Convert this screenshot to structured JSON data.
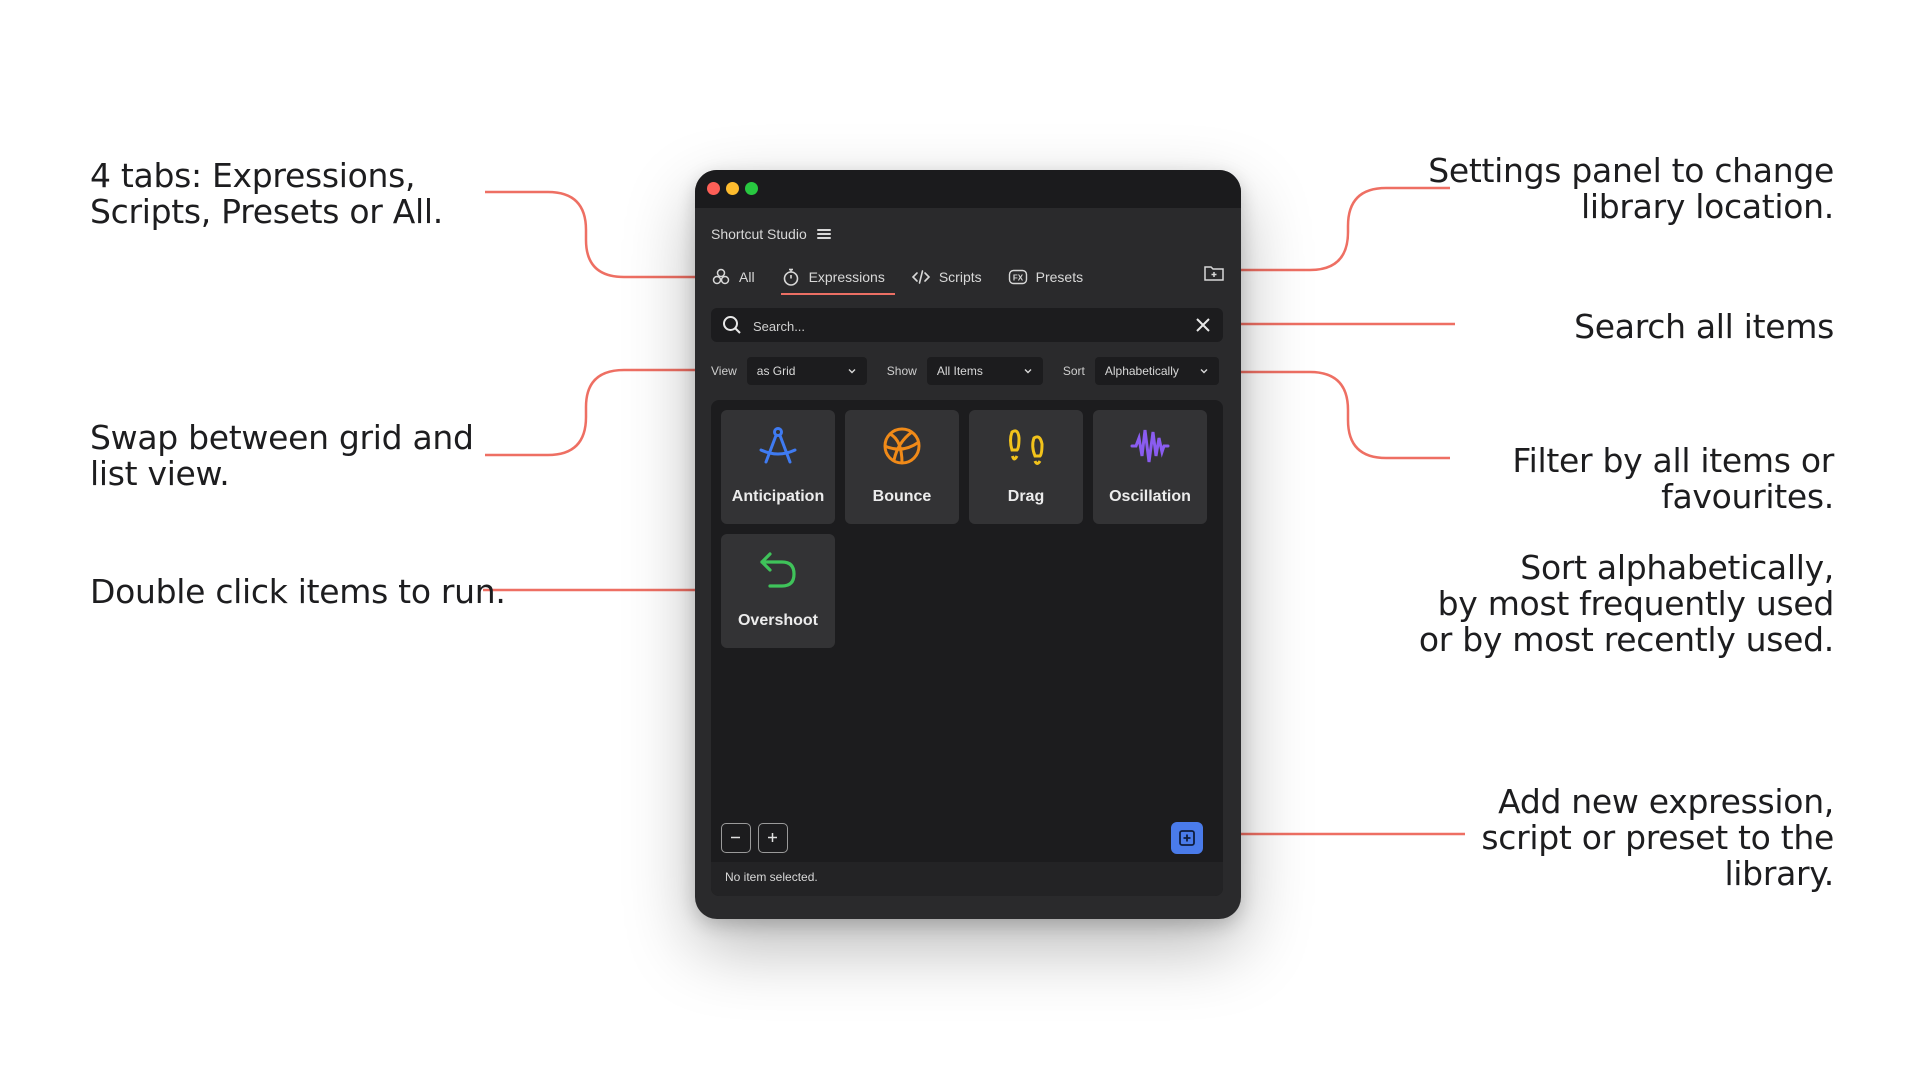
{
  "callouts": {
    "tabs": "4 tabs: Expressions,\nScripts, Presets or All.",
    "settings": "Settings panel to change\nlibrary location.",
    "search": "Search all items",
    "view": "Swap between grid and\nlist view.",
    "filter": "Filter by all items or\nfavourites.",
    "sort": "Sort alphabetically,\nby most frequently used\nor by most recently used.",
    "run": "Double click items to run.",
    "add": "Add new expression,\nscript or preset to the\nlibrary."
  },
  "app": {
    "title": "Shortcut Studio",
    "tabs": [
      {
        "label": "All",
        "icon": "all-icon"
      },
      {
        "label": "Expressions",
        "icon": "stopwatch-icon",
        "active": true
      },
      {
        "label": "Scripts",
        "icon": "code-icon"
      },
      {
        "label": "Presets",
        "icon": "fx-icon"
      }
    ],
    "search": {
      "placeholder": "Search..."
    },
    "controls": {
      "view_label": "View",
      "view_value": "as Grid",
      "show_label": "Show",
      "show_value": "All Items",
      "sort_label": "Sort",
      "sort_value": "Alphabetically"
    },
    "items": [
      {
        "label": "Anticipation",
        "icon": "compass-icon",
        "color": "#3f7bf2"
      },
      {
        "label": "Bounce",
        "icon": "ball-icon",
        "color": "#f08a18"
      },
      {
        "label": "Drag",
        "icon": "footprints-icon",
        "color": "#f2c31b"
      },
      {
        "label": "Oscillation",
        "icon": "wave-icon",
        "color": "#8a5cf0"
      },
      {
        "label": "Overshoot",
        "icon": "undo-arrow-icon",
        "color": "#3fc35a"
      }
    ],
    "status": "No item selected."
  },
  "colors": {
    "accent": "#ec6f64",
    "add_button": "#4a7bea"
  }
}
